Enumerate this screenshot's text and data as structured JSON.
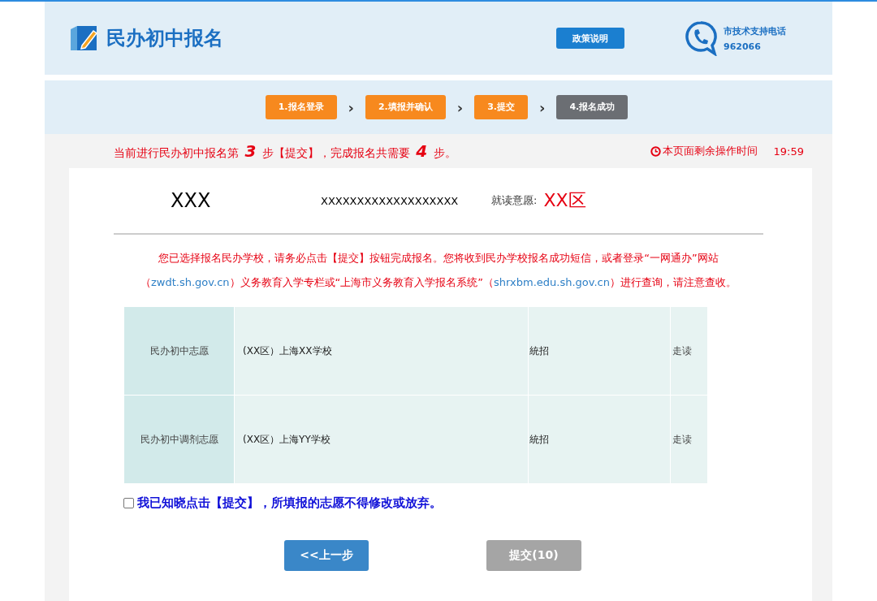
{
  "header": {
    "title": "民办初中报名",
    "policy_button": "政策说明",
    "support_label": "市技术支持电话",
    "support_phone": "962066"
  },
  "steps": [
    {
      "label": "1.报名登录",
      "done": true,
      "arrow": "›"
    },
    {
      "label": "2.填报并确认",
      "done": true,
      "arrow": "›"
    },
    {
      "label": "3.提交",
      "done": true,
      "arrow": "›"
    },
    {
      "label": "4.报名成功",
      "done": false
    }
  ],
  "progress_text": "当前进行民办初中报名第 *3* 步【提交】，完成报名共需要 *4* 步。",
  "timer": {
    "label": "本页面剩余操作时间",
    "time": "19:59"
  },
  "applicant": {
    "name": "XXX",
    "id_number": "XXXXXXXXXXXXXXXXXXX",
    "intent_label": "就读意愿:",
    "intent_value": "XX区"
  },
  "notice": [
    {
      "kind": "text",
      "text": "您已选择报名民办学校，请务必点击【提交】按钮完成报名。您将收到民办学校报名成功短信，或者登录“一网通办”网站"
    },
    {
      "kind": "text",
      "text": "（"
    },
    {
      "kind": "link",
      "text": "zwdt.sh.gov.cn"
    },
    {
      "kind": "text",
      "text": "）义务教育入学专栏或“上海市义务教育入学报名系统”（"
    },
    {
      "kind": "link",
      "text": "shrxbm.edu.sh.gov.cn"
    },
    {
      "kind": "text",
      "text": "）进行查询，请注意查收。"
    }
  ],
  "table": {
    "rows": [
      [
        "民办初中志愿",
        "(XX区）上海XX学校",
        "統招",
        "走读"
      ],
      [
        "民办初中调剂志愿",
        "(XX区）上海YY学校",
        "統招",
        "走读"
      ]
    ]
  },
  "agreement": {
    "checked": false,
    "text": "我已知晓点击【提交】，所填报的志愿不得修改或放弃。"
  },
  "buttons": [
    {
      "label": "<<上一步",
      "disabled": false
    },
    {
      "label": "提交(10)",
      "disabled": true
    }
  ]
}
